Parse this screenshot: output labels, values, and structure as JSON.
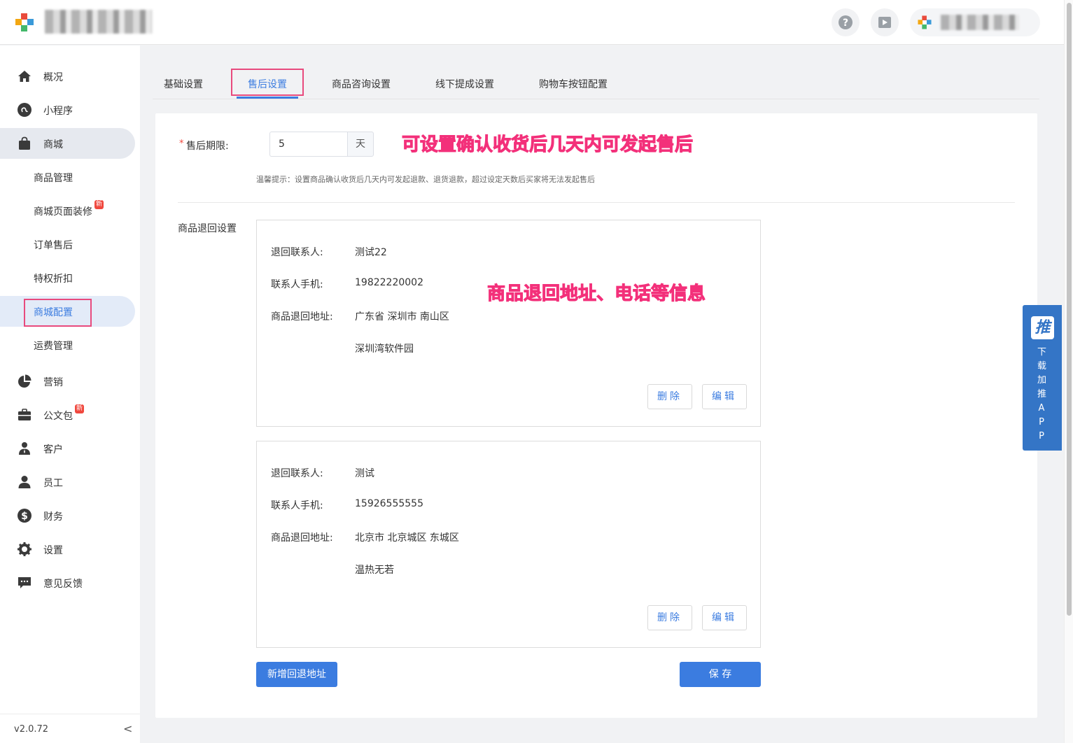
{
  "header": {
    "help_icon": "question-circle-icon",
    "video_icon": "play-video-icon"
  },
  "sidebar": {
    "items": [
      {
        "label": "概况",
        "icon": "home-icon"
      },
      {
        "label": "小程序",
        "icon": "mini-program-icon"
      },
      {
        "label": "商城",
        "icon": "shopping-bag-icon"
      },
      {
        "label": "营销",
        "icon": "pie-chart-icon"
      },
      {
        "label": "公文包",
        "icon": "briefcase-icon",
        "badge": "新"
      },
      {
        "label": "客户",
        "icon": "customer-icon"
      },
      {
        "label": "员工",
        "icon": "user-icon"
      },
      {
        "label": "财务",
        "icon": "dollar-icon"
      },
      {
        "label": "设置",
        "icon": "gear-icon"
      },
      {
        "label": "意见反馈",
        "icon": "comment-icon"
      }
    ],
    "sub_items": [
      {
        "label": "商品管理"
      },
      {
        "label": "商城页面装修",
        "badge": "新"
      },
      {
        "label": "订单售后"
      },
      {
        "label": "特权折扣"
      },
      {
        "label": "商城配置"
      },
      {
        "label": "运费管理"
      }
    ],
    "version": "v2.0.72",
    "collapse_label": "<"
  },
  "tabs": [
    {
      "label": "基础设置"
    },
    {
      "label": "售后设置"
    },
    {
      "label": "商品咨询设置"
    },
    {
      "label": "线下提成设置"
    },
    {
      "label": "购物车按钮配置"
    }
  ],
  "form": {
    "period_label": "售后期限:",
    "required_mark": "*",
    "period_value": "5",
    "period_unit": "天",
    "tip": "温馨提示：设置商品确认收货后几天内可发起退款、退货退款，超过设定天数后买家将无法发起售后",
    "section_label": "商品退回设置"
  },
  "annotations": {
    "period_note": "可设置确认收货后几天内可发起售后",
    "address_note": "商品退回地址、电话等信息"
  },
  "addresses": [
    {
      "contact_label": "退回联系人:",
      "contact": "测试22",
      "phone_label": "联系人手机:",
      "phone": "19822220002",
      "address_label": "商品退回地址:",
      "region": "广东省 深圳市 南山区",
      "detail": "深圳湾软件园",
      "delete_label": "删除",
      "edit_label": "编辑"
    },
    {
      "contact_label": "退回联系人:",
      "contact": "测试",
      "phone_label": "联系人手机:",
      "phone": "15926555555",
      "address_label": "商品退回地址:",
      "region": "北京市 北京城区 东城区",
      "detail": "温热无若",
      "delete_label": "删除",
      "edit_label": "编辑"
    }
  ],
  "actions": {
    "add_label": "新增回退地址",
    "save_label": "保 存"
  },
  "app_float": {
    "logo": "推",
    "text": "下载加推APP"
  },
  "colors": {
    "primary": "#3b7ce0",
    "annotation": "#f3307a",
    "highlight_box": "#e84a7d",
    "app_float": "#3475c6"
  }
}
